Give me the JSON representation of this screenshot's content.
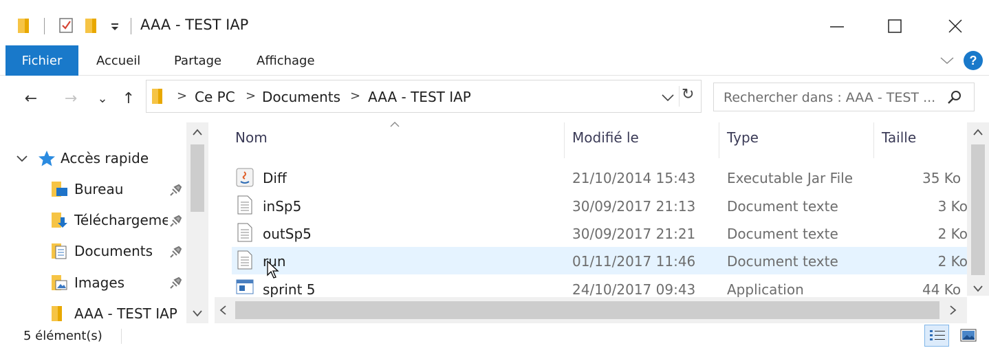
{
  "window": {
    "title": "AAA - TEST IAP",
    "controls": {
      "minimize": "—",
      "maximize": "☐",
      "close": "✕"
    }
  },
  "ribbon": {
    "tabs": [
      "Fichier",
      "Accueil",
      "Partage",
      "Affichage"
    ],
    "help": "?"
  },
  "nav": {
    "back": "←",
    "forward": "→",
    "recent": "⌄",
    "up": "↑",
    "address": [
      "Ce PC",
      "Documents",
      "AAA - TEST IAP"
    ],
    "address_dropdown": "⌄",
    "refresh": "↻",
    "search_placeholder": "Rechercher dans : AAA - TEST ..."
  },
  "navpane": {
    "quick_access": "Accès rapide",
    "items": [
      {
        "label": "Bureau",
        "icon": "desktop-folder-icon",
        "pinned": true
      },
      {
        "label": "Téléchargements",
        "icon": "downloads-folder-icon",
        "pinned": true
      },
      {
        "label": "Documents",
        "icon": "documents-folder-icon",
        "pinned": true
      },
      {
        "label": "Images",
        "icon": "images-folder-icon",
        "pinned": true
      },
      {
        "label": "AAA - TEST IAP",
        "icon": "folder-icon",
        "pinned": false
      }
    ]
  },
  "files": {
    "columns": [
      "Nom",
      "Modifié le",
      "Type",
      "Taille"
    ],
    "sort_indicator": "^",
    "rows": [
      {
        "name": "Diff",
        "modified": "21/10/2014 15:43",
        "type": "Executable Jar File",
        "size": "35 Ko",
        "icon": "java-jar-icon"
      },
      {
        "name": "inSp5",
        "modified": "30/09/2017 21:13",
        "type": "Document texte",
        "size": "3 Ko",
        "icon": "text-document-icon"
      },
      {
        "name": "outSp5",
        "modified": "30/09/2017 21:21",
        "type": "Document texte",
        "size": "2 Ko",
        "icon": "text-document-icon"
      },
      {
        "name": "run",
        "modified": "01/11/2017 11:46",
        "type": "Document texte",
        "size": "2 Ko",
        "icon": "text-document-icon",
        "hover": true
      },
      {
        "name": "sprint 5",
        "modified": "24/10/2017 09:43",
        "type": "Application",
        "size": "44 Ko",
        "icon": "application-icon"
      }
    ]
  },
  "status": {
    "count": "5 élément(s)"
  },
  "colors": {
    "accent": "#1979ca",
    "hover_row": "#e5f3ff",
    "folder": "#f6c445"
  }
}
